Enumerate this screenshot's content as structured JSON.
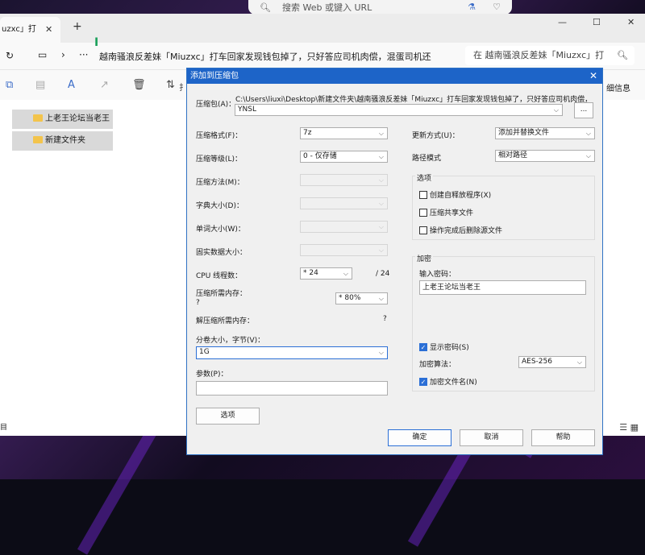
{
  "top_search": {
    "placeholder": "搜索 Web 或键入 URL"
  },
  "explorer": {
    "tab_title": "uzxc」打",
    "breadcrumb": "越南骚浪反差妹「Miuzxc」打车回家发现钱包掉了，只好答应司机肉偿，混蛋司机还",
    "search_placeholder": "在 越南骚浪反差妹「Miuzxc」打",
    "cmd_partial_label": "扌",
    "details_label": "细信息",
    "status_text": "目",
    "folders": [
      {
        "name": "上老王论坛当老王"
      },
      {
        "name": "新建文件夹"
      }
    ]
  },
  "dialog": {
    "title": "添加到压缩包",
    "archive_label": "压缩包(A)：",
    "archive_path": "C:\\Users\\liuxi\\Desktop\\新建文件夹\\越南骚浪反差妹「Miuzxc」打车回家发现钱包掉了，只好答应司机肉偿，混蛋司",
    "archive_name": "YNSL",
    "browse_label": "...",
    "left": {
      "format_label": "压缩格式(F)：",
      "format_value": "7z",
      "level_label": "压缩等级(L)：",
      "level_value": "0 - 仅存储",
      "method_label": "压缩方法(M)：",
      "dict_label": "字典大小(D)：",
      "word_label": "单词大小(W)：",
      "solid_label": "固实数据大小：",
      "cpu_label": "CPU 线程数：",
      "cpu_value": "* 24",
      "cpu_total": "/ 24",
      "mem_comp_label": "压缩所需内存：",
      "mem_comp_q": "?",
      "mem_comp_value": "* 80%",
      "mem_decomp_label": "解压缩所需内存：",
      "mem_decomp_q": "?",
      "split_label": "分卷大小，字节(V)：",
      "split_value": "1G",
      "params_label": "参数(P)：",
      "options_button": "选项"
    },
    "right": {
      "update_label": "更新方式(U)：",
      "update_value": "添加并替换文件",
      "path_label": "路径模式",
      "path_value": "相对路径",
      "options_group": "选项",
      "opt_sfx": "创建自释放程序(X)",
      "opt_shared": "压缩共享文件",
      "opt_delete": "操作完成后删除源文件",
      "enc_group": "加密",
      "pwd_label": "输入密码：",
      "pwd_value": "上老王论坛当老王",
      "show_pwd": "显示密码(S)",
      "enc_method_label": "加密算法：",
      "enc_method_value": "AES-256",
      "enc_names": "加密文件名(N)"
    },
    "ok": "确定",
    "cancel": "取消",
    "help": "帮助"
  }
}
